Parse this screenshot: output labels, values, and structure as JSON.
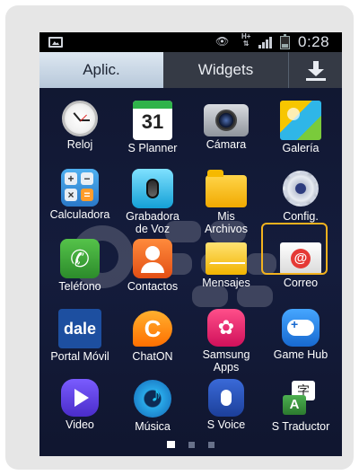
{
  "status_bar": {
    "time": "0:28",
    "network": "H+",
    "icons": [
      "image-icon",
      "eye-icon",
      "h-plus-icon",
      "signal-icon",
      "battery-icon"
    ]
  },
  "tabs": {
    "apps": "Aplic.",
    "widgets": "Widgets",
    "download_icon": "download-icon"
  },
  "apps": [
    {
      "label": "Reloj",
      "icon": "clock-icon"
    },
    {
      "label": "S Planner",
      "icon": "calendar-icon",
      "badge": "31"
    },
    {
      "label": "Cámara",
      "icon": "camera-icon"
    },
    {
      "label": "Galería",
      "icon": "gallery-icon"
    },
    {
      "label": "Calculadora",
      "icon": "calculator-icon"
    },
    {
      "label": "Grabadora de Voz",
      "icon": "microphone-icon"
    },
    {
      "label": "Mis Archivos",
      "icon": "folder-icon"
    },
    {
      "label": "Config.",
      "icon": "gear-icon"
    },
    {
      "label": "Teléfono",
      "icon": "phone-icon"
    },
    {
      "label": "Contactos",
      "icon": "contacts-icon"
    },
    {
      "label": "Mensajes",
      "icon": "messages-icon"
    },
    {
      "label": "Correo",
      "icon": "mail-icon"
    },
    {
      "label": "Portal Móvil",
      "icon": "dale-icon",
      "badge": "dale"
    },
    {
      "label": "ChatON",
      "icon": "chaton-icon"
    },
    {
      "label": "Samsung Apps",
      "icon": "samsung-apps-icon"
    },
    {
      "label": "Game Hub",
      "icon": "gamepad-icon"
    },
    {
      "label": "Video",
      "icon": "video-icon"
    },
    {
      "label": "Música",
      "icon": "music-icon"
    },
    {
      "label": "S Voice",
      "icon": "s-voice-icon"
    },
    {
      "label": "S Traductor",
      "icon": "translator-icon"
    }
  ],
  "highlight_color": "#f2b21e",
  "pager": {
    "pages": 3,
    "current": 1
  }
}
